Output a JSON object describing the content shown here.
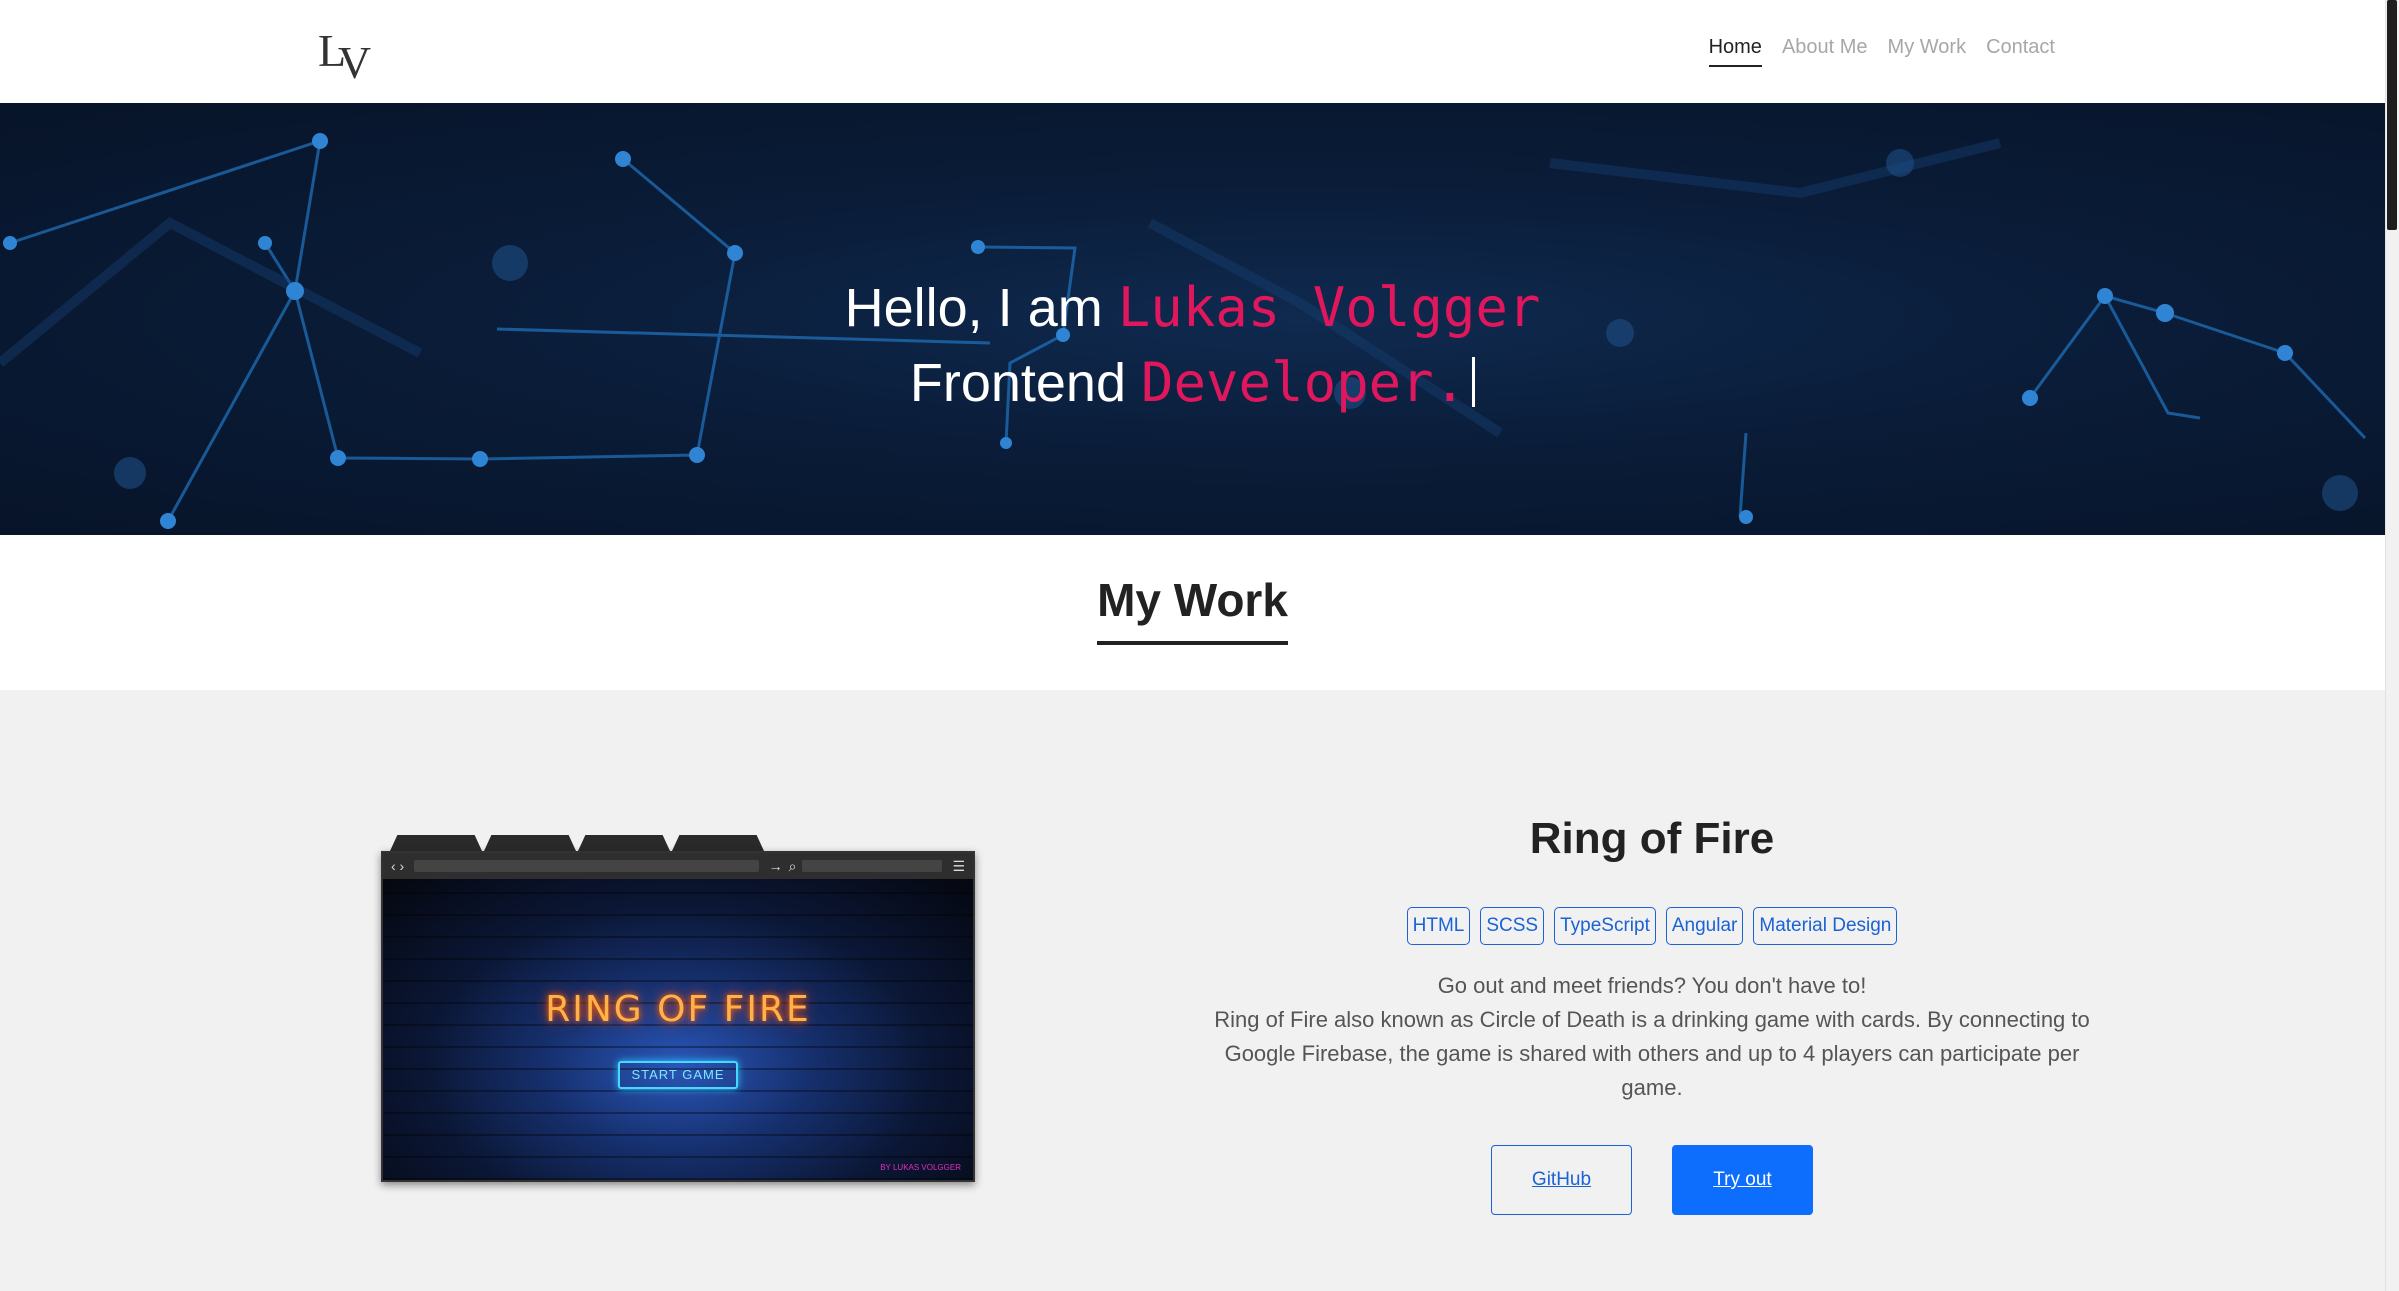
{
  "header": {
    "logo_l": "L",
    "logo_v": "V",
    "nav": [
      {
        "label": "Home",
        "active": true
      },
      {
        "label": "About Me",
        "active": false
      },
      {
        "label": "My Work",
        "active": false
      },
      {
        "label": "Contact",
        "active": false
      }
    ]
  },
  "hero": {
    "greeting": "Hello, I am",
    "name": "Lukas Volgger",
    "role_prefix": "Frontend",
    "role_typed": "Developer."
  },
  "section": {
    "title": "My Work"
  },
  "project": {
    "title": "Ring of Fire",
    "tags": [
      "HTML",
      "SCSS",
      "TypeScript",
      "Angular",
      "Material Design"
    ],
    "tagline": "Go out and meet friends? You don't have to!",
    "description": "Ring of Fire also known as Circle of Death is a drinking game with cards. By connecting to Google Firebase, the game is shared with others and up to 4 players can participate per game.",
    "github_label": "GitHub",
    "tryout_label": "Try out",
    "screenshot": {
      "game_title": "RING OF FIRE",
      "start_label": "START GAME",
      "signature": "BY LUKAS VOLGGER"
    }
  },
  "colors": {
    "accent_pink": "#e0175c",
    "primary_blue": "#0d6efd",
    "hero_bg": "#0a1c38"
  }
}
